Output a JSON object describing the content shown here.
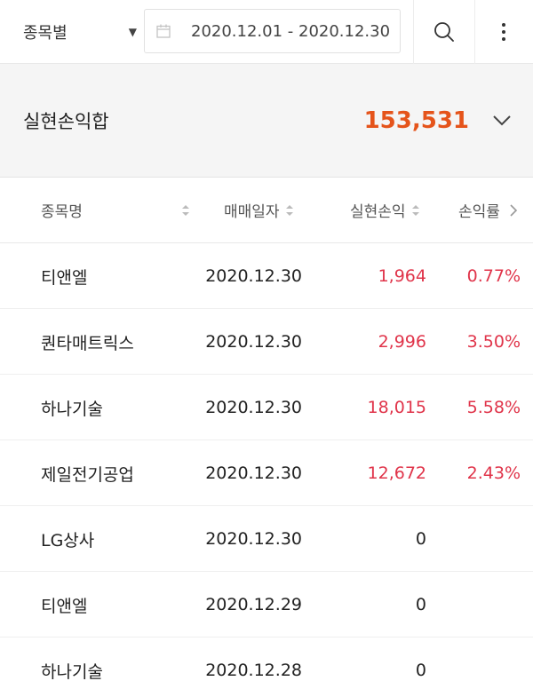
{
  "header": {
    "filter_label": "종목별",
    "date_range": "2020.12.01 - 2020.12.30"
  },
  "summary": {
    "title": "실현손익합",
    "value": "153,531"
  },
  "table": {
    "columns": [
      "종목명",
      "매매일자",
      "실현손익",
      "손익률"
    ],
    "rows": [
      {
        "name": "티앤엘",
        "date": "2020.12.30",
        "pl": "1,964",
        "rate": "0.77%"
      },
      {
        "name": "퀀타매트릭스",
        "date": "2020.12.30",
        "pl": "2,996",
        "rate": "3.50%"
      },
      {
        "name": "하나기술",
        "date": "2020.12.30",
        "pl": "18,015",
        "rate": "5.58%"
      },
      {
        "name": "제일전기공업",
        "date": "2020.12.30",
        "pl": "12,672",
        "rate": "2.43%"
      },
      {
        "name": "LG상사",
        "date": "2020.12.30",
        "pl": "0",
        "rate": ""
      },
      {
        "name": "티앤엘",
        "date": "2020.12.29",
        "pl": "0",
        "rate": ""
      },
      {
        "name": "하나기술",
        "date": "2020.12.28",
        "pl": "0",
        "rate": ""
      }
    ]
  },
  "colors": {
    "summary_value": "#e5541b",
    "profit": "#e0344a"
  },
  "icons": [
    "calendar-icon",
    "search-icon",
    "more-vertical-icon",
    "chevron-down-icon",
    "sort-icon",
    "chevron-right-icon"
  ]
}
